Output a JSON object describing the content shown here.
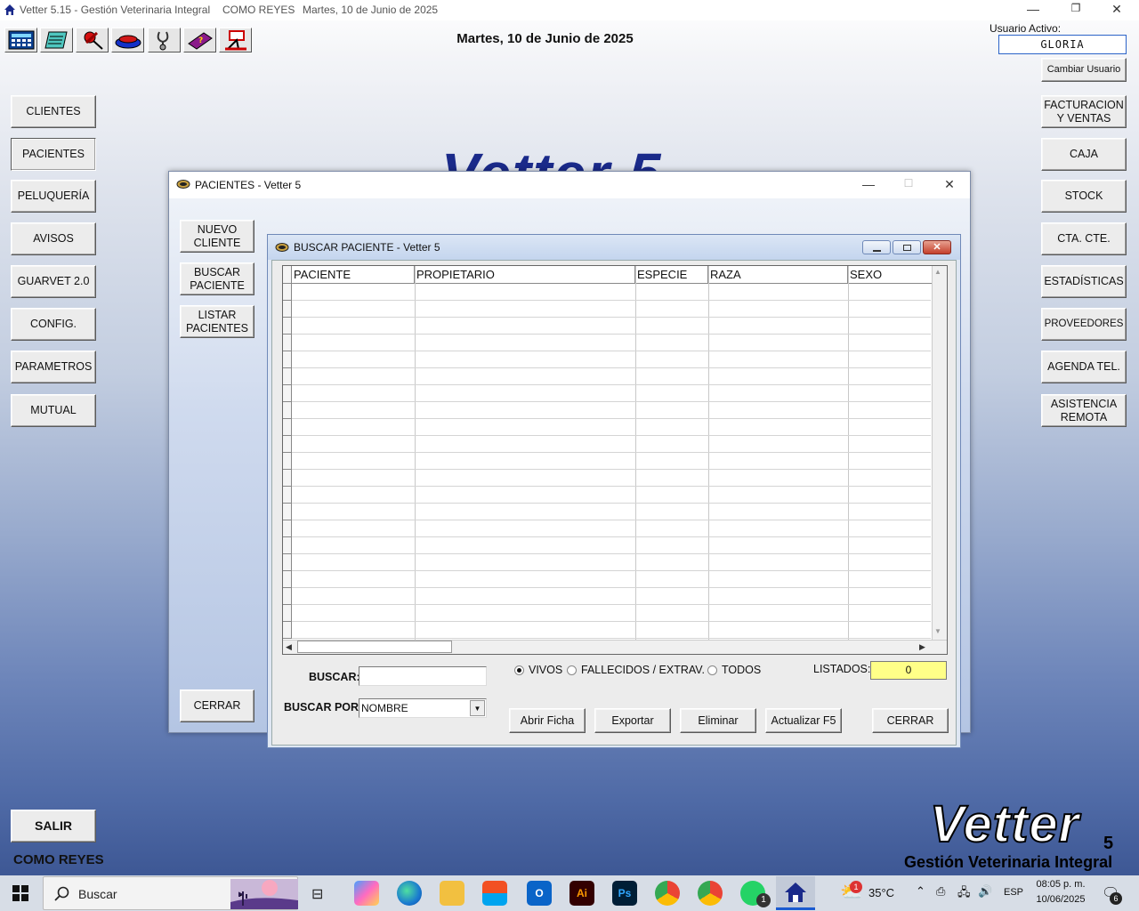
{
  "titlebar": {
    "app": "Vetter 5.15 - Gestión Veterinaria Integral",
    "branch": "COMO REYES",
    "date": "Martes, 10 de Junio de 2025",
    "minimize": "—",
    "restore": "❐",
    "close": "✕"
  },
  "header": {
    "date": "Martes, 10 de Junio de 2025",
    "user_label": "Usuario Activo:",
    "user_name": "GLORIA",
    "change_user": "Cambiar Usuario"
  },
  "toolbar": {
    "icons": [
      "calculator-icon",
      "notepad-icon",
      "pushpin-icon",
      "pet-bowl-icon",
      "stethoscope-icon",
      "help-book-icon",
      "sign-icon"
    ]
  },
  "left_menu": {
    "clientes": "CLIENTES",
    "pacientes": "PACIENTES",
    "peluqueria": "PELUQUERÍA",
    "avisos": "AVISOS",
    "guarvet": "GUARVET 2.0",
    "config": "CONFIG.",
    "parametros": "PARAMETROS",
    "mutual": "MUTUAL",
    "salir": "SALIR"
  },
  "right_menu": {
    "facturacion_1": "FACTURACION",
    "facturacion_2": "Y VENTAS",
    "caja": "CAJA",
    "stock": "STOCK",
    "cta_cte": "CTA. CTE.",
    "estadisticas": "ESTADÍSTICAS",
    "proveedores": "PROVEEDORES",
    "agenda": "AGENDA TEL.",
    "asistencia_1": "ASISTENCIA",
    "asistencia_2": "REMOTA"
  },
  "background": {
    "watermark": "Vetter 5",
    "branch_footer": "COMO REYES",
    "logo_text": "Vetter",
    "logo_version": "5",
    "logo_subtitle": "Gestión Veterinaria Integral"
  },
  "pacientes_window": {
    "title": "PACIENTES - Vetter 5",
    "nuevo_1": "NUEVO",
    "nuevo_2": "CLIENTE",
    "buscar_1": "BUSCAR",
    "buscar_2": "PACIENTE",
    "listar_1": "LISTAR",
    "listar_2": "PACIENTES",
    "cerrar": "CERRAR"
  },
  "buscar_window": {
    "title": "BUSCAR PACIENTE - Vetter 5",
    "columns": [
      "PACIENTE",
      "PROPIETARIO",
      "ESPECIE",
      "RAZA",
      "SEXO"
    ],
    "buscar_label": "BUSCAR:",
    "buscar_value": "",
    "buscar_por_label": "BUSCAR POR:",
    "buscar_por_value": "NOMBRE",
    "radio_vivos": "VIVOS",
    "radio_fallecidos": "FALLECIDOS / EXTRAV.",
    "radio_todos": "TODOS",
    "listados_label": "LISTADOS:",
    "listados_value": "0",
    "abrir_ficha": "Abrir Ficha",
    "exportar": "Exportar",
    "eliminar": "Eliminar",
    "actualizar": "Actualizar F5",
    "cerrar": "CERRAR"
  },
  "taskbar": {
    "search": "Buscar",
    "temperature": "35°C",
    "language": "ESP",
    "time": "08:05 p. m.",
    "date": "10/06/2025",
    "notifications": "6",
    "weather_badge": "1",
    "whatsapp_badge": "1",
    "outlook_label": "O",
    "illustrator_label": "Ai",
    "photoshop_label": "Ps"
  }
}
